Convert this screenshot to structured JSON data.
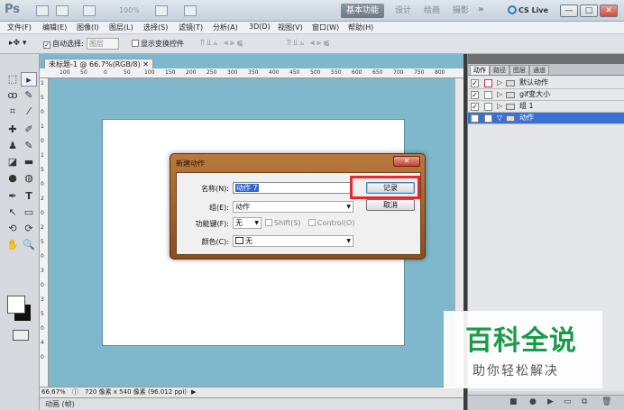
{
  "app": {
    "logo": "Ps",
    "zoom": "100%",
    "workspaces": [
      "基本功能",
      "设计",
      "绘画",
      "摄影"
    ],
    "more": "»",
    "cs_live": "CS Live",
    "window_buttons": [
      "—",
      "□",
      "✕"
    ]
  },
  "menu": [
    "文件(F)",
    "编辑(E)",
    "图像(I)",
    "图层(L)",
    "选择(S)",
    "滤镜(T)",
    "分析(A)",
    "3D(D)",
    "视图(V)",
    "窗口(W)",
    "帮助(H)"
  ],
  "options": {
    "auto_select_label": "自动选择:",
    "auto_select_value": "图层",
    "show_transform_label": "显示变换控件"
  },
  "document": {
    "tab_title": "未标题-1 @ 66.7%(RGB/8)",
    "tab_close": "✕",
    "ruler_top": [
      "100",
      "50",
      "0",
      "50",
      "100",
      "150",
      "200",
      "250",
      "300",
      "350",
      "400",
      "450",
      "500",
      "550",
      "600",
      "650",
      "700",
      "750",
      "800"
    ],
    "ruler_left": [
      "1",
      "5",
      "0",
      "1",
      "0",
      "1",
      "5",
      "0",
      "2",
      "0",
      "2",
      "5",
      "0",
      "3",
      "0",
      "3",
      "5",
      "0",
      "4",
      "0"
    ],
    "status_zoom": "66.67%",
    "status_info": "720 像素 x 540 像素 (96.012 ppi)",
    "bottom_tab": "动画 (帧)"
  },
  "right_panel": {
    "tabs": [
      "动作",
      "路径",
      "图层",
      "通道"
    ],
    "actions": [
      {
        "label": "默认动作",
        "checked": true
      },
      {
        "label": "gif变大小",
        "checked": true
      },
      {
        "label": "组 1",
        "checked": true
      },
      {
        "label": "动作",
        "checked": false
      }
    ]
  },
  "dialog": {
    "title": "新建动作",
    "name_label": "名称(N):",
    "name_value": "动作 7",
    "group_label": "组(E):",
    "group_value": "动作",
    "fkey_label": "功能键(F):",
    "fkey_value": "无",
    "shift_label": "Shift(S)",
    "control_label": "Control(O)",
    "color_label": "颜色(C):",
    "color_value": "无",
    "record_button": "记录",
    "cancel_button": "取消"
  },
  "watermark": {
    "main": "百科全说",
    "sub": "助你轻松解决"
  }
}
